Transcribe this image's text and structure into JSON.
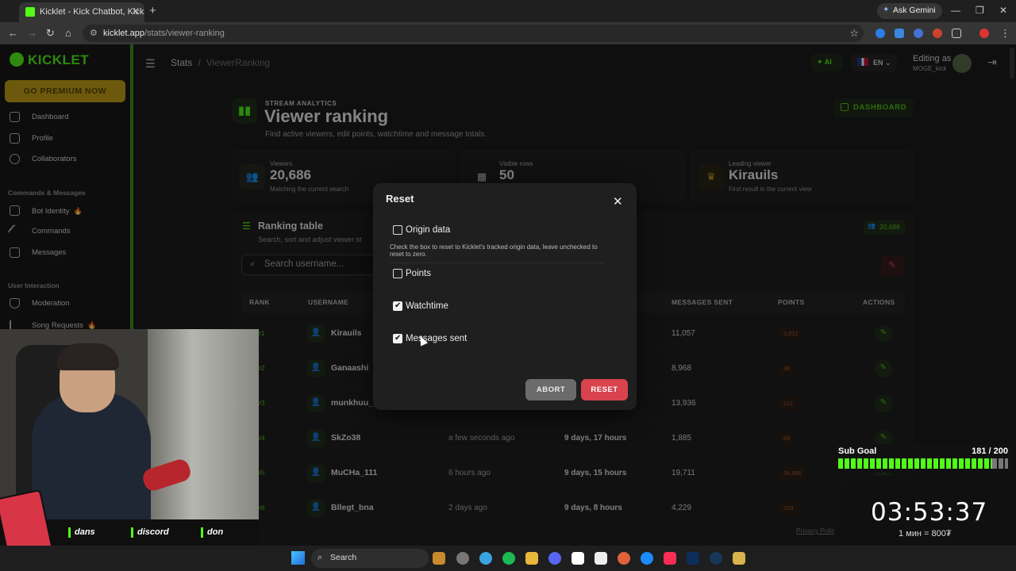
{
  "browser": {
    "tab_title": "Kicklet - Kick Chatbot, Kick Wi",
    "tab_close": "✕",
    "new_tab": "+",
    "gemini": "Ask Gemini",
    "url_host": "kicklet.app",
    "url_path": "/stats/viewer-ranking"
  },
  "sidebar": {
    "logo": "KICKLET",
    "premium": "GO PREMIUM NOW",
    "items_top": [
      {
        "label": "Dashboard",
        "icon": "grid-icon"
      },
      {
        "label": "Profile",
        "icon": "profile-icon"
      },
      {
        "label": "Collaborators",
        "icon": "people-icon"
      }
    ],
    "section_commands": "Commands & Messages",
    "items_commands": [
      {
        "label": "Bot Identity",
        "icon": "robot-icon",
        "badge": "🔥"
      },
      {
        "label": "Commands",
        "icon": "wand-icon"
      },
      {
        "label": "Messages",
        "icon": "message-icon"
      }
    ],
    "section_interaction": "User Interaction",
    "items_interaction": [
      {
        "label": "Moderation",
        "icon": "shield-icon"
      },
      {
        "label": "Song Requests",
        "icon": "music-icon",
        "badge": "🔥"
      }
    ]
  },
  "header": {
    "crumb_root": "Stats",
    "crumb_sep": "/",
    "crumb_current": "ViewerRanking",
    "ai_label": "AI",
    "lang": "EN",
    "editing_as": "Editing as",
    "username": "MOGE_kick"
  },
  "hero": {
    "eyebrow": "STREAM ANALYTICS",
    "title": "Viewer ranking",
    "subtitle": "Find active viewers, edit points, watchtime and message totals.",
    "dashboard_button": "DASHBOARD"
  },
  "stats": [
    {
      "label": "Viewers",
      "value": "20,686",
      "sub": "Matching the current search"
    },
    {
      "label": "Visible rows",
      "value": "50",
      "sub": ""
    },
    {
      "label": "Leading viewer",
      "value": "Kirauils",
      "sub": "First result in the current view"
    }
  ],
  "table": {
    "title": "Ranking table",
    "subtitle": "Search, sort and adjust viewer st",
    "count": "20,686",
    "search_placeholder": "Search username...",
    "headers": {
      "rank": "RANK",
      "username": "USERNAME",
      "messages": "MESSAGES SENT",
      "points": "POINTS",
      "actions": "ACTIONS"
    },
    "rows": [
      {
        "rank": "#1",
        "username": "Kirauils",
        "last": "",
        "watch": "",
        "msgs": "11,057",
        "pts": "1,012"
      },
      {
        "rank": "#2",
        "username": "Ganaashi",
        "last": "",
        "watch": "",
        "msgs": "8,968",
        "pts": "38"
      },
      {
        "rank": "#3",
        "username": "munkhuu_",
        "last": "",
        "watch": "",
        "msgs": "13,936",
        "pts": "112"
      },
      {
        "rank": "#4",
        "username": "SkZo38",
        "last": "a few seconds ago",
        "watch": "9 days, 17 hours",
        "msgs": "1,885",
        "pts": "88"
      },
      {
        "rank": "#5",
        "username": "MuCHa_111",
        "last": "6 hours ago",
        "watch": "9 days, 15 hours",
        "msgs": "19,711",
        "pts": "26,366"
      },
      {
        "rank": "#6",
        "username": "Bllegt_bna",
        "last": "2 days ago",
        "watch": "9 days, 8 hours",
        "msgs": "4,229",
        "pts": "223"
      }
    ],
    "privacy": "Privacy Policy"
  },
  "modal": {
    "title": "Reset",
    "close": "✕",
    "origin_label": "Origin data",
    "origin_checked": false,
    "help": "Check the box to reset to Kicklet's tracked origin data, leave unchecked to reset to zero.",
    "options": [
      {
        "label": "Points",
        "checked": false
      },
      {
        "label": "Watchtime",
        "checked": true
      },
      {
        "label": "Messages sent",
        "checked": true
      }
    ],
    "abort": "ABORT",
    "reset": "RESET"
  },
  "stream": {
    "commands": [
      "dans",
      "discord",
      "don"
    ],
    "sub_goal_label": "Sub Goal",
    "sub_goal_value": "181 / 200",
    "sub_goal_progress": 0.905,
    "timer": "03:53:37",
    "rate": "1 мин = 800₮"
  },
  "taskbar": {
    "search": "Search"
  }
}
